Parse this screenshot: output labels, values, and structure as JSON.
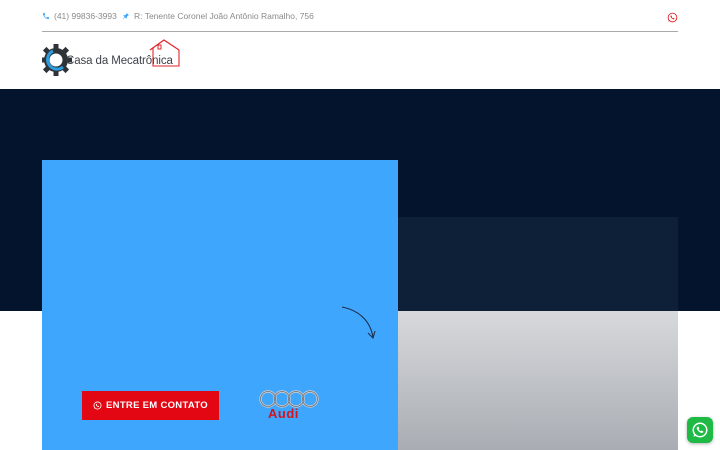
{
  "topbar": {
    "phone": "(41) 99836-3993",
    "address": "R: Tenente Coronel João Antônio Ramalho, 756"
  },
  "logo": {
    "text": "Casa da Mecatrônica"
  },
  "hero": {
    "cta_label": "ENTRE EM CONTATO",
    "brand_name": "Audi"
  },
  "icons": {
    "phone": "phone-icon",
    "address": "map-pin-icon",
    "whatsapp": "whatsapp-icon",
    "arrow": "curved-arrow-icon"
  },
  "colors": {
    "accent_blue": "#3fa6fd",
    "hero_dark": "#03142c",
    "cta_red": "#e30613",
    "whatsapp_green": "#1fba45",
    "whatsapp_red_icon": "#e0262b"
  }
}
